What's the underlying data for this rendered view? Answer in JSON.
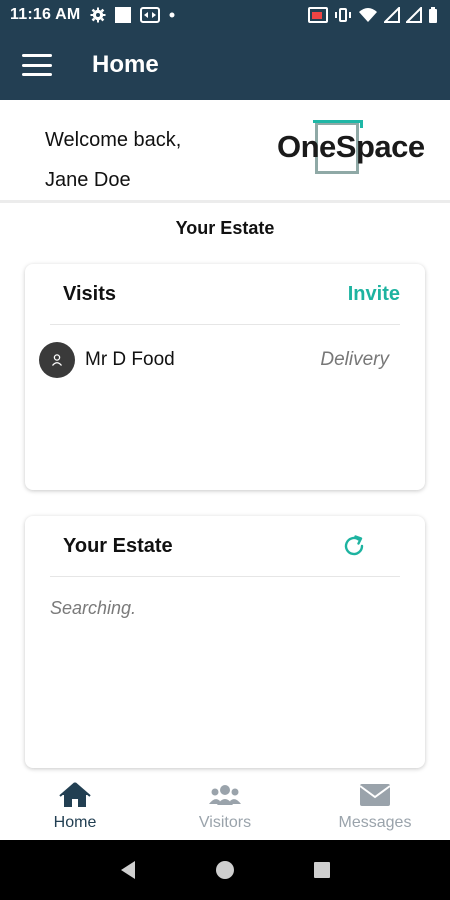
{
  "status_bar": {
    "time": "11:16 AM",
    "icons_left": [
      "gear-icon",
      "white-square-icon",
      "teamviewer-icon",
      "dot-icon"
    ],
    "icons_right": [
      "cast-icon",
      "vibrate-icon",
      "wifi-icon",
      "signal-icon",
      "signal-icon-2",
      "battery-icon"
    ]
  },
  "app_bar": {
    "menu_icon": "hamburger-menu-icon",
    "title": "Home"
  },
  "welcome": {
    "line1": "Welcome back,",
    "line2": "Jane Doe",
    "logo_text": "OneSpace"
  },
  "section_title": "Your Estate",
  "visits_card": {
    "title": "Visits",
    "action": "Invite",
    "visits": [
      {
        "name": "Mr D Food",
        "type": "Delivery",
        "avatar_icon": "person-icon"
      }
    ]
  },
  "estate_card": {
    "title": "Your Estate",
    "refresh_icon": "refresh-icon",
    "status": "Searching."
  },
  "bottom_nav": {
    "items": [
      {
        "label": "Home",
        "icon": "home-icon",
        "active": true
      },
      {
        "label": "Visitors",
        "icon": "users-icon",
        "active": false
      },
      {
        "label": "Messages",
        "icon": "envelope-icon",
        "active": false
      }
    ]
  },
  "system_nav": {
    "buttons": [
      "back-icon",
      "home-circle-icon",
      "recents-icon"
    ]
  },
  "colors": {
    "app_bar": "#233f53",
    "accent": "#1db3a0",
    "active_nav": "#223f52",
    "inactive_nav": "#9aa3ab"
  }
}
